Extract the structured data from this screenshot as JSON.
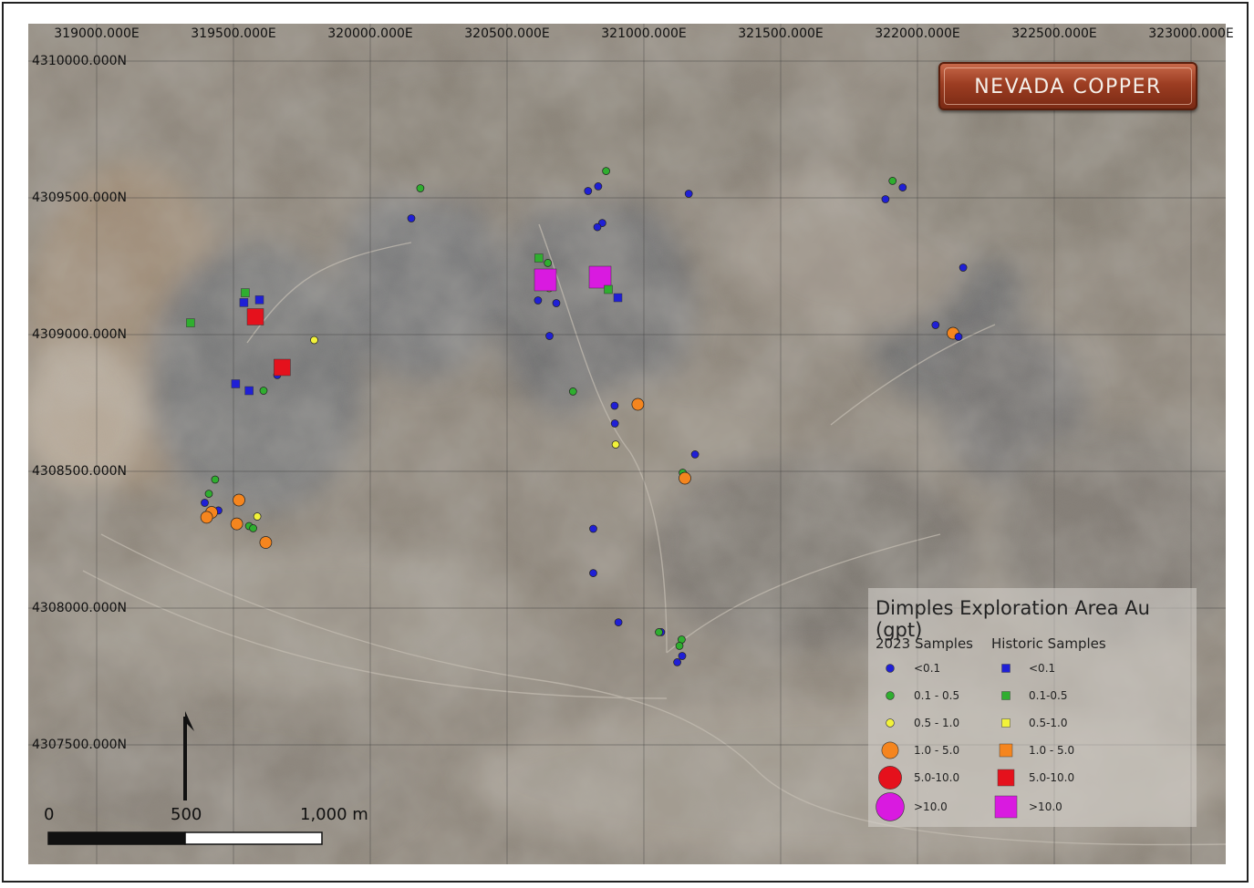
{
  "colors": {
    "lt0.1": "#1f1fd6",
    "0.1-0.5": "#2fae2f",
    "0.5-1.0": "#f2f23a",
    "1.0-5.0": "#f5851e",
    "5.0-10.0": "#e5111c",
    ">10.0": "#d91ae0"
  },
  "grid": {
    "eastings": [
      {
        "value": 319000,
        "label": "319000.000E"
      },
      {
        "value": 319500,
        "label": "319500.000E"
      },
      {
        "value": 320000,
        "label": "320000.000E"
      },
      {
        "value": 320500,
        "label": "320500.000E"
      },
      {
        "value": 321000,
        "label": "321000.000E"
      },
      {
        "value": 321500,
        "label": "321500.000E"
      },
      {
        "value": 322000,
        "label": "322000.000E"
      },
      {
        "value": 322500,
        "label": "322500.000E"
      },
      {
        "value": 323000,
        "label": "323000.000E"
      }
    ],
    "northings": [
      {
        "value": 4310000,
        "label": "4310000.000N"
      },
      {
        "value": 4309500,
        "label": "4309500.000N"
      },
      {
        "value": 4309000,
        "label": "4309000.000N"
      },
      {
        "value": 4308500,
        "label": "4308500.000N"
      },
      {
        "value": 4308000,
        "label": "4308000.000N"
      },
      {
        "value": 4307500,
        "label": "4307500.000N"
      }
    ]
  },
  "logo": {
    "text": "NEVADA COPPER"
  },
  "legend": {
    "title": "Dimples Exploration Area Au (gpt)",
    "col_2023": "2023 Samples",
    "col_hist": "Historic Samples",
    "rows": [
      {
        "cls": "lt0.1",
        "label_2023": "<0.1",
        "label_hist": "<0.1"
      },
      {
        "cls": "0.1-0.5",
        "label_2023": "0.1 - 0.5",
        "label_hist": "0.1-0.5"
      },
      {
        "cls": "0.5-1.0",
        "label_2023": "0.5 - 1.0",
        "label_hist": "0.5-1.0"
      },
      {
        "cls": "1.0-5.0",
        "label_2023": "1.0 - 5.0",
        "label_hist": "1.0 - 5.0"
      },
      {
        "cls": "5.0-10.0",
        "label_2023": "5.0-10.0",
        "label_hist": "5.0-10.0"
      },
      {
        "cls": ">10.0",
        "label_2023": ">10.0",
        "label_hist": ">10.0"
      }
    ]
  },
  "scale_bar": {
    "labels": [
      "0",
      "500",
      "1,000 m"
    ]
  },
  "samples_2023": [
    {
      "e": 320183,
      "n": 4309535,
      "c": "0.1-0.5"
    },
    {
      "e": 320150,
      "n": 4309425,
      "c": "lt0.1"
    },
    {
      "e": 320862,
      "n": 4309598,
      "c": "0.1-0.5"
    },
    {
      "e": 320796,
      "n": 4309525,
      "c": "lt0.1"
    },
    {
      "e": 320833,
      "n": 4309542,
      "c": "lt0.1"
    },
    {
      "e": 320848,
      "n": 4309408,
      "c": "lt0.1"
    },
    {
      "e": 320830,
      "n": 4309393,
      "c": "lt0.1"
    },
    {
      "e": 321164,
      "n": 4309515,
      "c": "lt0.1"
    },
    {
      "e": 321909,
      "n": 4309562,
      "c": "0.1-0.5"
    },
    {
      "e": 321883,
      "n": 4309495,
      "c": "lt0.1"
    },
    {
      "e": 321946,
      "n": 4309538,
      "c": "lt0.1"
    },
    {
      "e": 322167,
      "n": 4309245,
      "c": "lt0.1"
    },
    {
      "e": 320649,
      "n": 4309262,
      "c": "0.1-0.5"
    },
    {
      "e": 320654,
      "n": 4309170,
      "c": "0.5-1.0"
    },
    {
      "e": 320613,
      "n": 4309125,
      "c": "lt0.1"
    },
    {
      "e": 320680,
      "n": 4309115,
      "c": "lt0.1"
    },
    {
      "e": 320655,
      "n": 4308995,
      "c": "lt0.1"
    },
    {
      "e": 322066,
      "n": 4309035,
      "c": "lt0.1"
    },
    {
      "e": 322130,
      "n": 4309005,
      "c": "1.0-5.0"
    },
    {
      "e": 322150,
      "n": 4308992,
      "c": "lt0.1"
    },
    {
      "e": 319795,
      "n": 4308980,
      "c": "0.5-1.0"
    },
    {
      "e": 319660,
      "n": 4308852,
      "c": "lt0.1"
    },
    {
      "e": 319610,
      "n": 4308795,
      "c": "0.1-0.5"
    },
    {
      "e": 320741,
      "n": 4308792,
      "c": "0.1-0.5"
    },
    {
      "e": 320893,
      "n": 4308740,
      "c": "lt0.1"
    },
    {
      "e": 320978,
      "n": 4308745,
      "c": "1.0-5.0"
    },
    {
      "e": 320894,
      "n": 4308675,
      "c": "lt0.1"
    },
    {
      "e": 320897,
      "n": 4308598,
      "c": "0.5-1.0"
    },
    {
      "e": 321187,
      "n": 4308562,
      "c": "lt0.1"
    },
    {
      "e": 321142,
      "n": 4308495,
      "c": "0.1-0.5"
    },
    {
      "e": 321150,
      "n": 4308475,
      "c": "1.0-5.0"
    },
    {
      "e": 319433,
      "n": 4308470,
      "c": "0.1-0.5"
    },
    {
      "e": 319410,
      "n": 4308418,
      "c": "0.1-0.5"
    },
    {
      "e": 319395,
      "n": 4308385,
      "c": "lt0.1"
    },
    {
      "e": 319445,
      "n": 4308357,
      "c": "lt0.1"
    },
    {
      "e": 319420,
      "n": 4308350,
      "c": "1.0-5.0"
    },
    {
      "e": 319402,
      "n": 4308332,
      "c": "1.0-5.0"
    },
    {
      "e": 319520,
      "n": 4308395,
      "c": "1.0-5.0"
    },
    {
      "e": 319587,
      "n": 4308335,
      "c": "0.5-1.0"
    },
    {
      "e": 319512,
      "n": 4308308,
      "c": "1.0-5.0"
    },
    {
      "e": 319557,
      "n": 4308300,
      "c": "0.1-0.5"
    },
    {
      "e": 319572,
      "n": 4308292,
      "c": "0.1-0.5"
    },
    {
      "e": 319618,
      "n": 4308240,
      "c": "1.0-5.0"
    },
    {
      "e": 320815,
      "n": 4308290,
      "c": "lt0.1"
    },
    {
      "e": 320815,
      "n": 4308128,
      "c": "lt0.1"
    },
    {
      "e": 320907,
      "n": 4307948,
      "c": "lt0.1"
    },
    {
      "e": 321063,
      "n": 4307912,
      "c": "lt0.1"
    },
    {
      "e": 321055,
      "n": 4307912,
      "c": "0.1-0.5"
    },
    {
      "e": 321138,
      "n": 4307885,
      "c": "0.1-0.5"
    },
    {
      "e": 321130,
      "n": 4307862,
      "c": "0.1-0.5"
    },
    {
      "e": 321140,
      "n": 4307825,
      "c": "lt0.1"
    },
    {
      "e": 321122,
      "n": 4307802,
      "c": "lt0.1"
    }
  ],
  "samples_historic": [
    {
      "e": 320616,
      "n": 4309280,
      "c": "0.1-0.5"
    },
    {
      "e": 320640,
      "n": 4309200,
      "c": ">10.0"
    },
    {
      "e": 320840,
      "n": 4309210,
      "c": ">10.0"
    },
    {
      "e": 320870,
      "n": 4309165,
      "c": "0.1-0.5"
    },
    {
      "e": 320905,
      "n": 4309135,
      "c": "lt0.1"
    },
    {
      "e": 319543,
      "n": 4309153,
      "c": "0.1-0.5"
    },
    {
      "e": 319538,
      "n": 4309117,
      "c": "lt0.1"
    },
    {
      "e": 319595,
      "n": 4309127,
      "c": "lt0.1"
    },
    {
      "e": 319580,
      "n": 4309065,
      "c": "5.0-10.0"
    },
    {
      "e": 319343,
      "n": 4309043,
      "c": "0.1-0.5"
    },
    {
      "e": 319678,
      "n": 4308880,
      "c": "5.0-10.0"
    },
    {
      "e": 319508,
      "n": 4308820,
      "c": "lt0.1"
    },
    {
      "e": 319557,
      "n": 4308795,
      "c": "lt0.1"
    }
  ]
}
